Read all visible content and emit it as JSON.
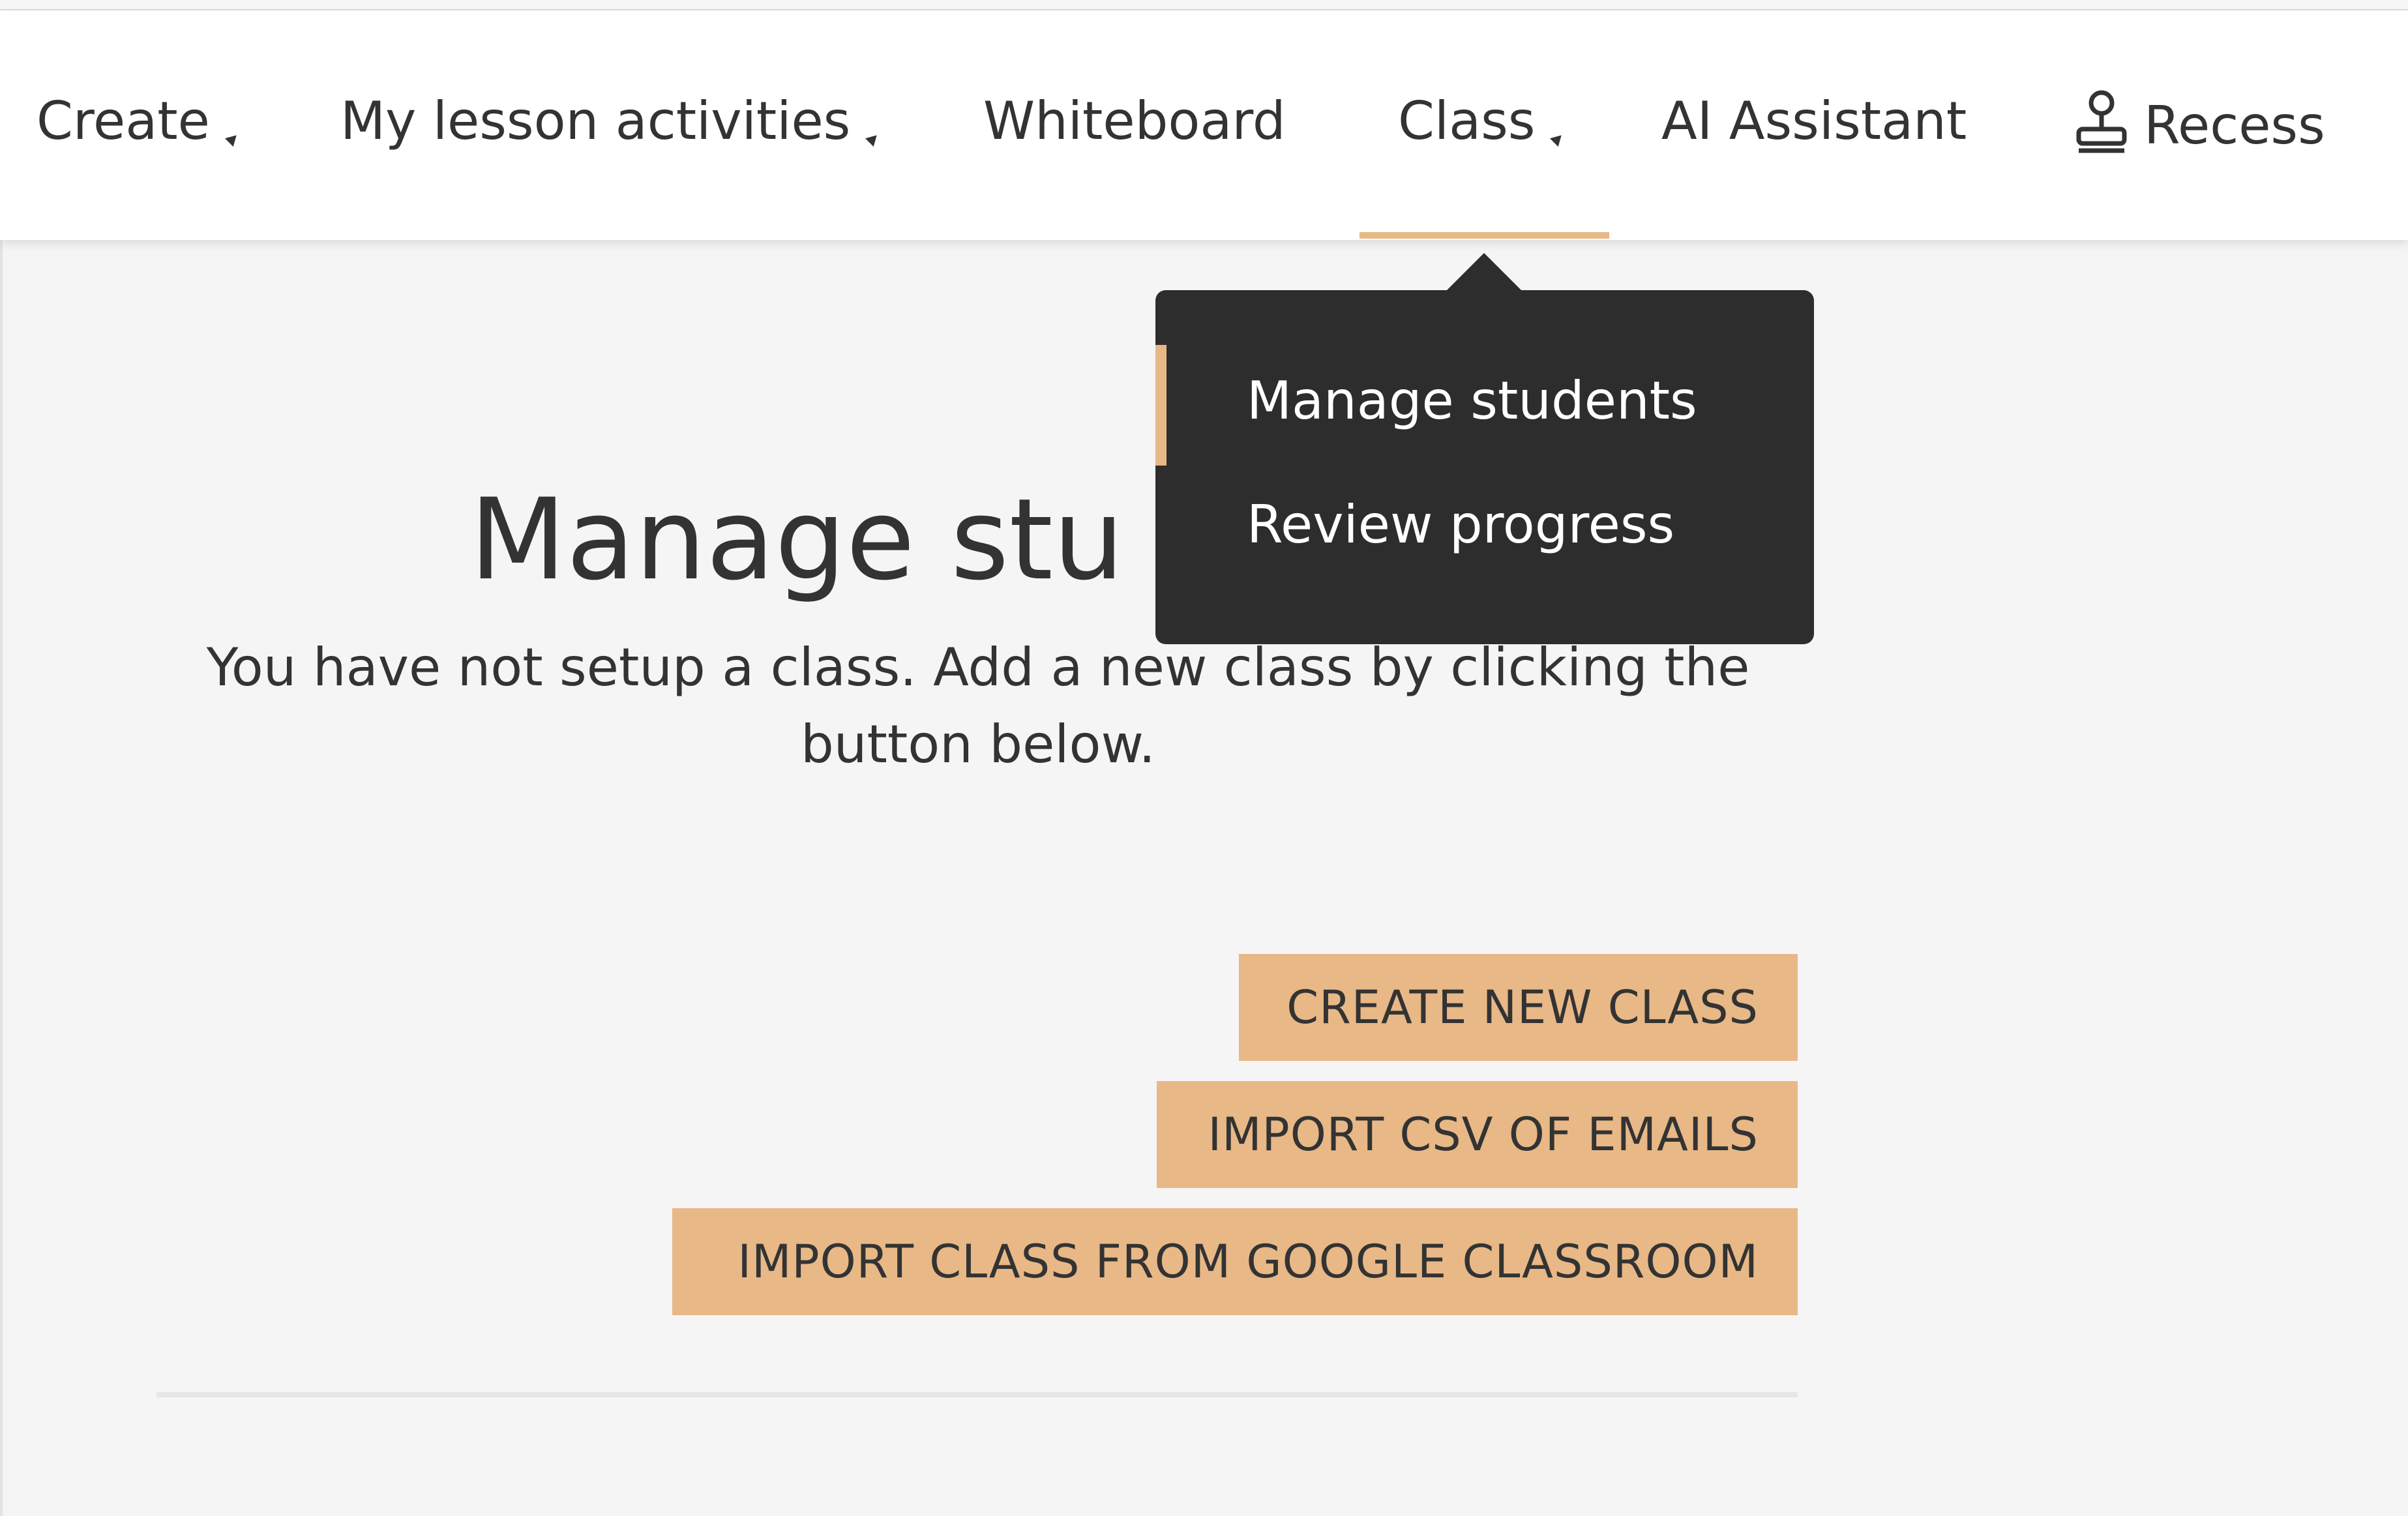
{
  "nav": {
    "create": "Create",
    "lessons": "My lesson activities",
    "whiteboard": "Whiteboard",
    "class": "Class",
    "ai": "AI Assistant",
    "recess": "Recess"
  },
  "dropdown": {
    "items": [
      "Manage students",
      "Review progress"
    ]
  },
  "main": {
    "title": "Manage stu",
    "description": "You have not setup a class. Add a new class by clicking the button below."
  },
  "buttons": {
    "create": "CREATE NEW CLASS",
    "csv": "IMPORT CSV OF EMAILS",
    "google": "IMPORT CLASS FROM GOOGLE CLASSROOM"
  },
  "colors": {
    "accent": "#e8b886",
    "dropdown_bg": "#2d2d2d",
    "background": "#f5f5f5",
    "text": "#333333"
  },
  "icons": {
    "caret": "caret-down-icon",
    "recess": "stamp-icon"
  }
}
